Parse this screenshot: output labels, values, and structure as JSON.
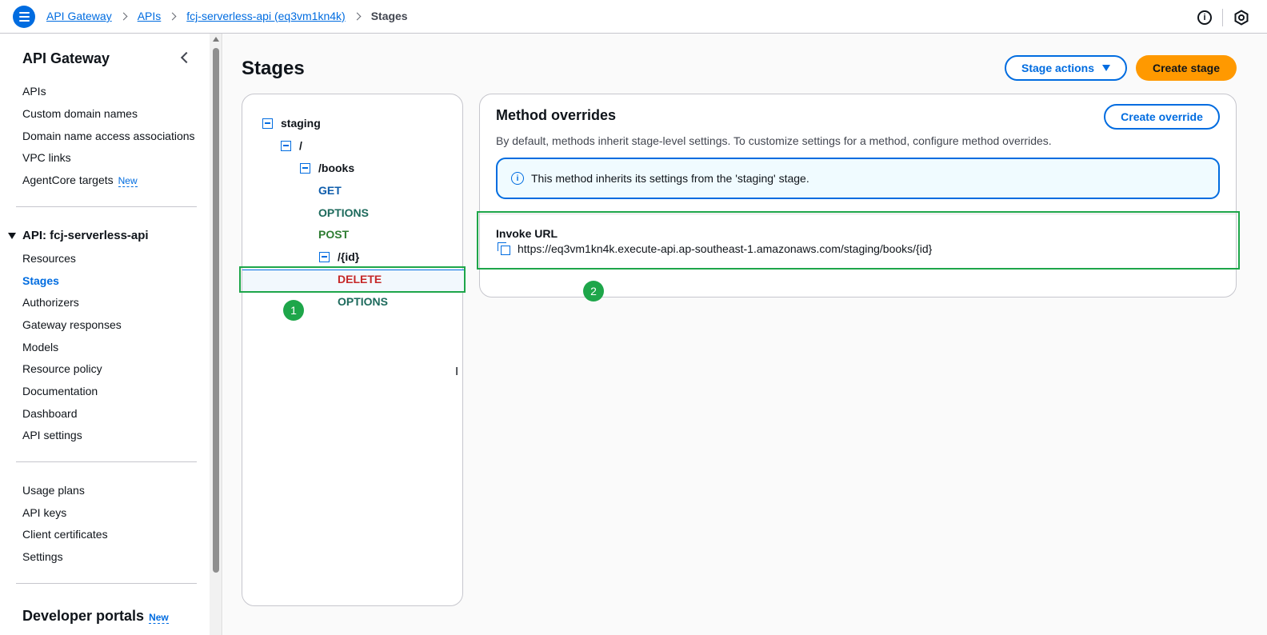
{
  "breadcrumbs": {
    "items": [
      "API Gateway",
      "APIs",
      "fcj-serverless-api (eq3vm1kn4k)"
    ],
    "current": "Stages"
  },
  "top_icons": [
    "info-icon",
    "settings-hex-icon"
  ],
  "sidebar": {
    "title": "API Gateway",
    "items": [
      {
        "label": "APIs"
      },
      {
        "label": "Custom domain names"
      },
      {
        "label": "Domain name access associations"
      },
      {
        "label": "VPC links"
      },
      {
        "label": "AgentCore targets",
        "badge": "New"
      }
    ],
    "api_section": {
      "title": "API: fcj-serverless-api",
      "items": [
        {
          "label": "Resources"
        },
        {
          "label": "Stages",
          "active": true
        },
        {
          "label": "Authorizers"
        },
        {
          "label": "Gateway responses"
        },
        {
          "label": "Models"
        },
        {
          "label": "Resource policy"
        },
        {
          "label": "Documentation"
        },
        {
          "label": "Dashboard"
        },
        {
          "label": "API settings"
        }
      ]
    },
    "other_items": [
      {
        "label": "Usage plans"
      },
      {
        "label": "API keys"
      },
      {
        "label": "Client certificates"
      },
      {
        "label": "Settings"
      }
    ],
    "developer_portals": {
      "label": "Developer portals",
      "badge": "New"
    }
  },
  "main": {
    "title": "Stages",
    "stage_actions_label": "Stage actions",
    "create_stage_label": "Create stage",
    "tree": {
      "stage": "staging",
      "root": "/",
      "books": "/books",
      "get": "GET",
      "options1": "OPTIONS",
      "post": "POST",
      "id": "/{id}",
      "delete": "DELETE",
      "options2": "OPTIONS"
    },
    "method_overrides": {
      "title": "Method overrides",
      "create_override_label": "Create override",
      "description": "By default, methods inherit stage-level settings. To customize settings for a method, configure method overrides.",
      "alert": "This method inherits its settings from the 'staging' stage.",
      "invoke_url_label": "Invoke URL",
      "invoke_url": "https://eq3vm1kn4k.execute-api.ap-southeast-1.amazonaws.com/staging/books/{id}"
    },
    "markers": [
      "1",
      "2"
    ],
    "text_cursor": "I"
  },
  "colors": {
    "accent": "#006ce0",
    "primary_button": "#ff9900",
    "annotation_green": "#1ea64a",
    "delete_method": "#c62828"
  }
}
